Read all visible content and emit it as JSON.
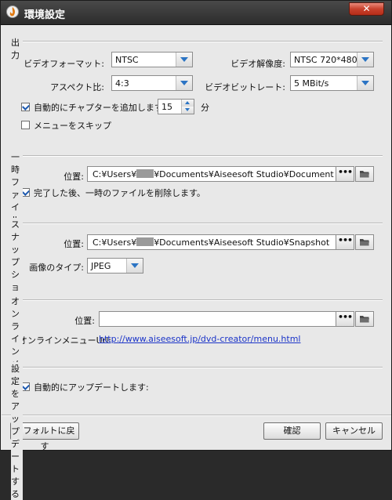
{
  "window": {
    "title": "環境設定"
  },
  "output": {
    "heading": "出力",
    "video_format": {
      "label": "ビデオフォーマット:",
      "value": "NTSC"
    },
    "video_resolution": {
      "label": "ビデオ解像度:",
      "value": "NTSC 720*480"
    },
    "aspect_ratio": {
      "label": "アスペクト比:",
      "value": "4:3"
    },
    "video_bitrate": {
      "label": "ビデオビットレート:",
      "value": "5 MBit/s"
    },
    "auto_chapter": {
      "label": "自動的にチャプターを追加します",
      "checked": true,
      "value": "15",
      "unit": "分"
    },
    "skip_menu": {
      "label": "メニューをスキップ",
      "checked": false
    }
  },
  "temp": {
    "heading": "一時ファイル",
    "location_label": "位置:",
    "path_prefix": "C:¥Users¥",
    "path_suffix": "¥Documents¥Aiseesoft Studio¥Document",
    "browse_label": "•••",
    "delete_after": {
      "label": "完了した後、一時のファイルを削除します。",
      "checked": true
    }
  },
  "snapshot": {
    "heading": "スナップショット",
    "location_label": "位置:",
    "path_prefix": "C:¥Users¥",
    "path_suffix": "¥Documents¥Aiseesoft Studio¥Snapshot",
    "browse_label": "•••",
    "image_type_label": "画像のタイプ:",
    "image_type_value": "JPEG"
  },
  "online_menu": {
    "heading": "オンラインメニュー",
    "location_label": "位置:",
    "location_value": "",
    "browse_label": "•••",
    "url_label": "オンラインメニューUrl:",
    "url": "http://www.aiseesoft.jp/dvd-creator/menu.html"
  },
  "update": {
    "heading": "設定をアップデートする",
    "auto_update": {
      "label": "自動的にアップデートします:",
      "checked": true
    }
  },
  "footer": {
    "default_label": "デフォルトに戻す",
    "ok_label": "確認",
    "cancel_label": "キャンセル"
  },
  "colors": {
    "accent_arrow": "#2b74c4",
    "link": "#1b34c8",
    "close": "#c8412c"
  }
}
